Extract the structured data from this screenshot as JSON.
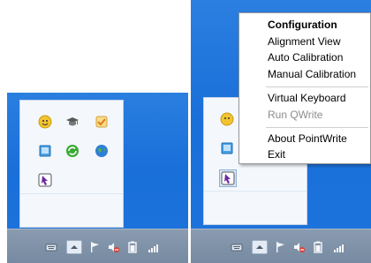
{
  "panels": {
    "left": {
      "tray_icons": [
        "help-icon",
        "graduation-cap-icon",
        "task-icon",
        "book-icon",
        "sync-icon",
        "globe-icon",
        "pointwrite-icon"
      ]
    },
    "right": {
      "tray_icons": [
        "help-icon",
        "book-icon",
        "pointwrite-icon"
      ]
    }
  },
  "taskbar": {
    "icons": [
      "keyboard-icon",
      "show-hidden-icons-button",
      "flag-icon",
      "volume-muted-icon",
      "power-icon",
      "signal-icon"
    ]
  },
  "context_menu": {
    "items": [
      {
        "label": "Configuration",
        "style": "bold"
      },
      {
        "label": "Alignment View",
        "style": "normal"
      },
      {
        "label": "Auto Calibration",
        "style": "normal"
      },
      {
        "label": "Manual Calibration",
        "style": "normal"
      },
      {
        "label": "Virtual Keyboard",
        "style": "normal"
      },
      {
        "label": "Run QWrite",
        "style": "disabled"
      },
      {
        "label": "About PointWrite",
        "style": "normal"
      },
      {
        "label": "Exit",
        "style": "normal"
      }
    ]
  },
  "colors": {
    "desktop": "#1a6fd9",
    "taskbar": "#7f91a7",
    "menu_background": "#ffffff",
    "disabled_text": "#8c8c8c"
  }
}
